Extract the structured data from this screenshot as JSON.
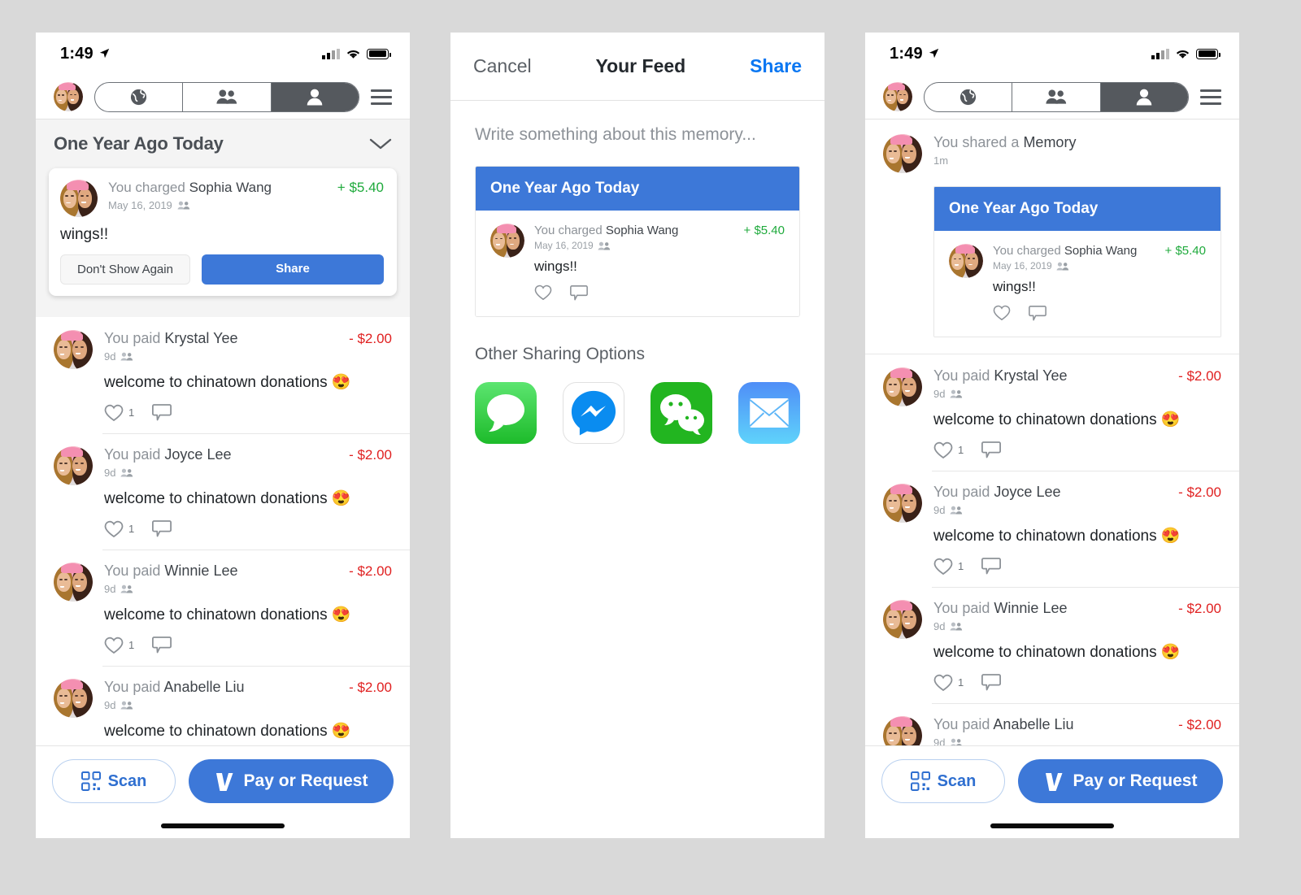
{
  "colors": {
    "venmo_blue": "#3D78D8",
    "link_blue": "#0A77F2",
    "positive_green": "#1FAA3C",
    "negative_red": "#E02020",
    "page_background": "#D9D9D9",
    "segment_active": "#55595E"
  },
  "status_bar": {
    "time": "1:49",
    "location_icon": "location-arrow-icon",
    "signal_icon": "cellular-signal-icon",
    "wifi_icon": "wifi-icon",
    "battery_icon": "battery-full-icon"
  },
  "nav_bar": {
    "avatar_icon": "user-avatar-photo",
    "segments": [
      {
        "icon": "globe-icon",
        "name": "public-feed",
        "active": false
      },
      {
        "icon": "friends-icon",
        "name": "friends-feed",
        "active": false
      },
      {
        "icon": "person-icon",
        "name": "mine-feed",
        "active": true
      }
    ],
    "menu_icon": "hamburger-menu-icon"
  },
  "left_panel": {
    "section": {
      "title": "One Year Ago Today",
      "collapse_icon": "chevron-down-icon"
    },
    "memory_card": {
      "actor_prefix": "You charged ",
      "counterparty": "Sophia Wang",
      "date": "May 16, 2019",
      "audience_icon": "friends-privacy-icon",
      "amount": "+ $5.40",
      "note": "wings!!",
      "dismiss_label": "Don't Show Again",
      "share_label": "Share"
    }
  },
  "feed_items": [
    {
      "actor_prefix": "You paid ",
      "counterparty": "Krystal Yee",
      "time": "9d",
      "audience_icon": "friends-privacy-icon",
      "amount": "- $2.00",
      "note": "welcome to chinatown donations 😍",
      "like_count": "1",
      "like_icon": "heart-outline-icon",
      "comment_icon": "comment-bubble-icon"
    },
    {
      "actor_prefix": "You paid ",
      "counterparty": "Joyce Lee",
      "time": "9d",
      "audience_icon": "friends-privacy-icon",
      "amount": "- $2.00",
      "note": "welcome to chinatown donations 😍",
      "like_count": "1",
      "like_icon": "heart-outline-icon",
      "comment_icon": "comment-bubble-icon"
    },
    {
      "actor_prefix": "You paid ",
      "counterparty": "Winnie Lee",
      "time": "9d",
      "audience_icon": "friends-privacy-icon",
      "amount": "- $2.00",
      "note": "welcome to chinatown donations 😍",
      "like_count": "1",
      "like_icon": "heart-outline-icon",
      "comment_icon": "comment-bubble-icon"
    },
    {
      "actor_prefix": "You paid ",
      "counterparty": "Anabelle Liu",
      "time": "9d",
      "audience_icon": "friends-privacy-icon",
      "amount": "- $2.00",
      "note": "welcome to chinatown donations 😍",
      "like_count": "",
      "like_icon": "heart-outline-icon",
      "comment_icon": "comment-bubble-icon"
    }
  ],
  "action_bar": {
    "scan_label": "Scan",
    "scan_icon": "qr-code-icon",
    "pay_label": "Pay or Request",
    "venmo_icon": "venmo-v-logo"
  },
  "middle_panel": {
    "nav": {
      "cancel_label": "Cancel",
      "title": "Your Feed",
      "share_label": "Share"
    },
    "compose_placeholder": "Write something about this memory...",
    "preview": {
      "header": "One Year Ago Today",
      "actor_prefix": "You charged ",
      "counterparty": "Sophia Wang",
      "date": "May 16, 2019",
      "audience_icon": "friends-privacy-icon",
      "amount": "+ $5.40",
      "note": "wings!!",
      "like_icon": "heart-outline-icon",
      "comment_icon": "comment-bubble-icon"
    },
    "other_sharing_label": "Other Sharing Options",
    "share_targets": [
      {
        "name": "messages",
        "icon": "messages-app-icon"
      },
      {
        "name": "messenger",
        "icon": "facebook-messenger-icon"
      },
      {
        "name": "wechat",
        "icon": "wechat-app-icon"
      },
      {
        "name": "mail",
        "icon": "mail-app-icon"
      }
    ]
  },
  "right_panel": {
    "shared_post": {
      "actor_prefix": "You shared a ",
      "object": "Memory",
      "time": "1m",
      "card_header": "One Year Ago Today",
      "card_actor_prefix": "You charged ",
      "card_counterparty": "Sophia Wang",
      "card_date": "May 16, 2019",
      "card_amount": "+ $5.40",
      "card_note": "wings!!",
      "like_icon": "heart-outline-icon",
      "comment_icon": "comment-bubble-icon"
    }
  }
}
